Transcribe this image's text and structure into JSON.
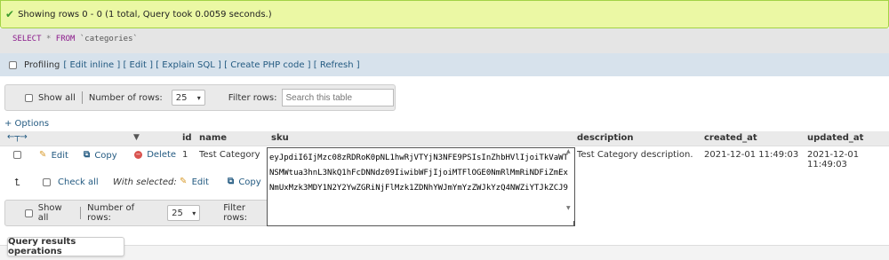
{
  "message": {
    "text": "Showing rows 0 - 0 (1 total, Query took 0.0059 seconds.)",
    "icon": "check-icon",
    "color": "#ebf8a4"
  },
  "query": {
    "select": "SELECT",
    "star": "*",
    "from": "FROM",
    "table": "`categories`"
  },
  "profiling": {
    "label": "Profiling",
    "links": [
      "[ Edit inline ]",
      "[ Edit ]",
      "[ Explain SQL ]",
      "[ Create PHP code ]",
      "[ Refresh ]"
    ]
  },
  "nav_top": {
    "show_all": "Show all",
    "number_of_rows": "Number of rows:",
    "rows_value": "25",
    "filter_rows": "Filter rows:",
    "filter_placeholder": "Search this table"
  },
  "options_link": "+ Options",
  "columns": [
    "id",
    "name",
    "sku",
    "description",
    "created_at",
    "updated_at"
  ],
  "row": {
    "actions": [
      "Edit",
      "Copy",
      "Delete"
    ],
    "id": "1",
    "name": "Test Category",
    "sku": "eyJpdiI6IjMzc08zRDRoK0pNL1hwRjVTYjN3NFE9PSIsInZhbHVlIjoiTkVaWTNSMWtua3hnL3NkQ1hFcDNNdz09IiwibWFjIjoiMTFlOGE0NmRlMmRiNDFiZmExNmUxMzk3MDY1N2Y2YwZGRiNjFlMzk1ZDNhYWJmYmYzZWJkYzQ4NWZiYTJkZCJ9",
    "description": "Test Category description.",
    "created_at": "2021-12-01 11:49:03",
    "updated_at": "2021-12-01 11:49:03"
  },
  "bulk": {
    "check_all": "Check all",
    "with_selected": "With selected:",
    "edit": "Edit",
    "copy": "Copy"
  },
  "nav_bottom": {
    "show_all": "Show all",
    "number_of_rows": "Number of rows:",
    "rows_value": "25",
    "filter_rows": "Filter rows:"
  },
  "query_results_operations": "Query results operations"
}
